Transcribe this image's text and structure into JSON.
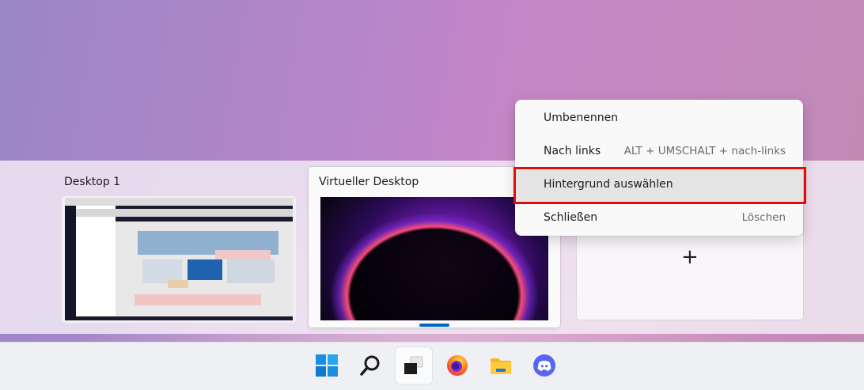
{
  "desktops": [
    {
      "label": "Desktop 1"
    },
    {
      "label": "Virtueller Desktop"
    }
  ],
  "new_desktop": {
    "icon": "plus-icon"
  },
  "context_menu": {
    "items": [
      {
        "label": "Umbenennen",
        "shortcut": ""
      },
      {
        "label": "Nach links",
        "shortcut": "ALT + UMSCHALT + nach-links"
      },
      {
        "label": "Hintergrund auswählen",
        "shortcut": ""
      },
      {
        "label": "Schließen",
        "shortcut": "Löschen"
      }
    ],
    "highlighted_index": 2
  },
  "taskbar": {
    "icons": [
      "windows-start-icon",
      "search-icon",
      "task-view-icon",
      "firefox-icon",
      "file-explorer-icon",
      "discord-icon"
    ],
    "active": "task-view-icon"
  },
  "colors": {
    "accent": "#0067c0",
    "highlight_border": "#e00d0d"
  }
}
